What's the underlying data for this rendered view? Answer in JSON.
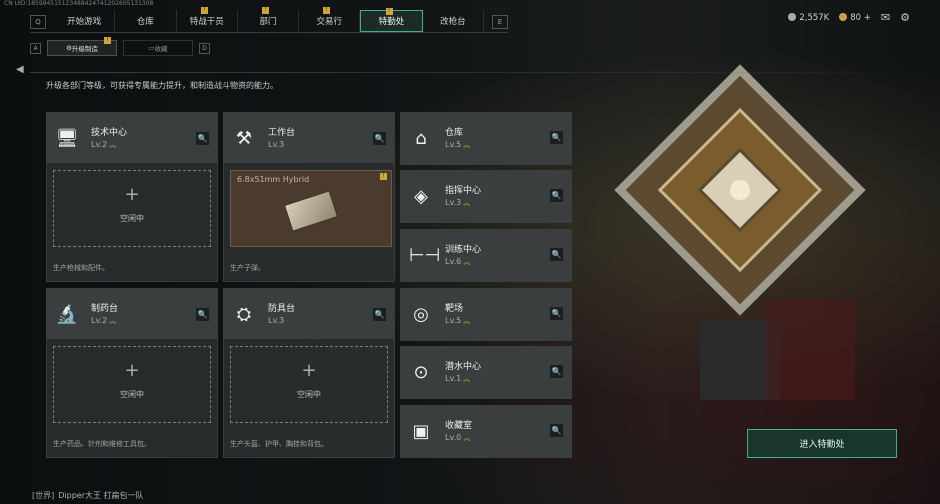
{
  "uid_text": "CN UID:1859945151234884247412026051313​08",
  "nav": {
    "left_key": "Q",
    "right_key": "E",
    "tabs": [
      {
        "label": "开始游戏"
      },
      {
        "label": "仓库"
      },
      {
        "label": "特战干员"
      },
      {
        "label": "部门"
      },
      {
        "label": "交易行"
      },
      {
        "label": "特勤处"
      },
      {
        "label": "改枪台"
      }
    ],
    "active_index": 5
  },
  "currency": {
    "silver": "2,557K",
    "gold": "80"
  },
  "subnav": {
    "left_key": "A",
    "right_key": "D",
    "tabs": [
      {
        "label": "升级制造"
      },
      {
        "label": "收藏"
      }
    ]
  },
  "description": "升级各部门等级，可获得专属能力提升，和制造战斗物资的能力。",
  "large_cards": [
    {
      "name": "技术中心",
      "level": "Lv.2",
      "icon": "computer-icon",
      "status": "空闲中",
      "desc": "生产枪械和配件。"
    },
    {
      "name": "工作台",
      "level": "Lv.3",
      "icon": "tools-icon",
      "product": "6.8x51mm Hybrid",
      "desc": "生产子弹。"
    },
    {
      "name": "制药台",
      "level": "Lv.2",
      "icon": "microscope-icon",
      "status": "空闲中",
      "desc": "生产药品、针剂和维修工具包。"
    },
    {
      "name": "防具台",
      "level": "Lv.3",
      "icon": "armor-icon",
      "status": "空闲中",
      "desc": "生产头盔、护甲、胸挂和背包。"
    }
  ],
  "small_cards": [
    {
      "name": "仓库",
      "level": "Lv.5",
      "icon": "warehouse-icon"
    },
    {
      "name": "指挥中心",
      "level": "Lv.3",
      "icon": "command-icon"
    },
    {
      "name": "训练中心",
      "level": "Lv.6",
      "icon": "dumbbell-icon"
    },
    {
      "name": "靶场",
      "level": "Lv.5",
      "icon": "target-icon"
    },
    {
      "name": "潜水中心",
      "level": "Lv.1",
      "icon": "diving-icon"
    },
    {
      "name": "收藏室",
      "level": "Lv.0",
      "icon": "collection-icon"
    }
  ],
  "enter_button": "进入特勤处",
  "chat": {
    "channel": "[世界]",
    "text": "Dipper大王  打扁包一队"
  }
}
